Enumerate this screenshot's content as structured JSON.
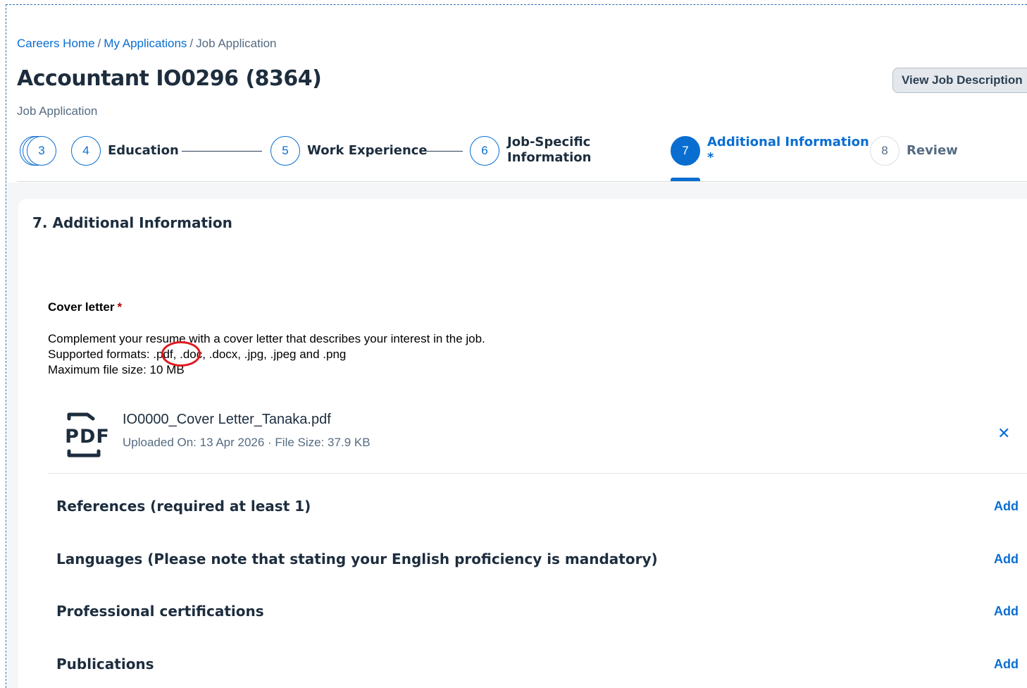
{
  "breadcrumb": {
    "home": "Careers Home",
    "sep": "/",
    "apps": "My Applications",
    "current": "Job Application"
  },
  "header": {
    "title": "Accountant IO0296 (8364)",
    "subtitle": "Job Application",
    "view_jd_label": "View Job Description"
  },
  "stepper": {
    "steps": [
      {
        "num": "3",
        "label": ""
      },
      {
        "num": "4",
        "label": "Education"
      },
      {
        "num": "5",
        "label": "Work Experience"
      },
      {
        "num": "6",
        "label_line1": "Job-Specific",
        "label_line2": "Information"
      },
      {
        "num": "7",
        "label": "Additional Information",
        "marker": "*"
      },
      {
        "num": "8",
        "label": "Review"
      }
    ]
  },
  "section": {
    "title": "7. Additional Information",
    "cover_letter": {
      "label": "Cover letter",
      "required": "*",
      "help_line1": "Complement your resume with a cover letter that describes your interest in the job.",
      "help_line2": "Supported formats: .pdf, .doc, .docx, .jpg, .jpeg and .png",
      "help_line3": "Maximum file size: 10 MB",
      "file": {
        "icon_text": "PDF",
        "name": "IO0000_Cover Letter_Tanaka.pdf",
        "meta": "Uploaded On: 13 Apr 2026 · File Size: 37.9 KB",
        "remove": "✕"
      }
    },
    "rows": [
      {
        "label": "References (required at least 1)",
        "action": "Add"
      },
      {
        "label": "Languages (Please note that stating your English proficiency is mandatory)",
        "action": "Add"
      },
      {
        "label": "Professional certifications",
        "action": "Add"
      },
      {
        "label": "Publications",
        "action": "Add"
      }
    ]
  },
  "colors": {
    "accent": "#0a6ed1",
    "required": "#aa0808",
    "highlight": "#e0191f"
  }
}
